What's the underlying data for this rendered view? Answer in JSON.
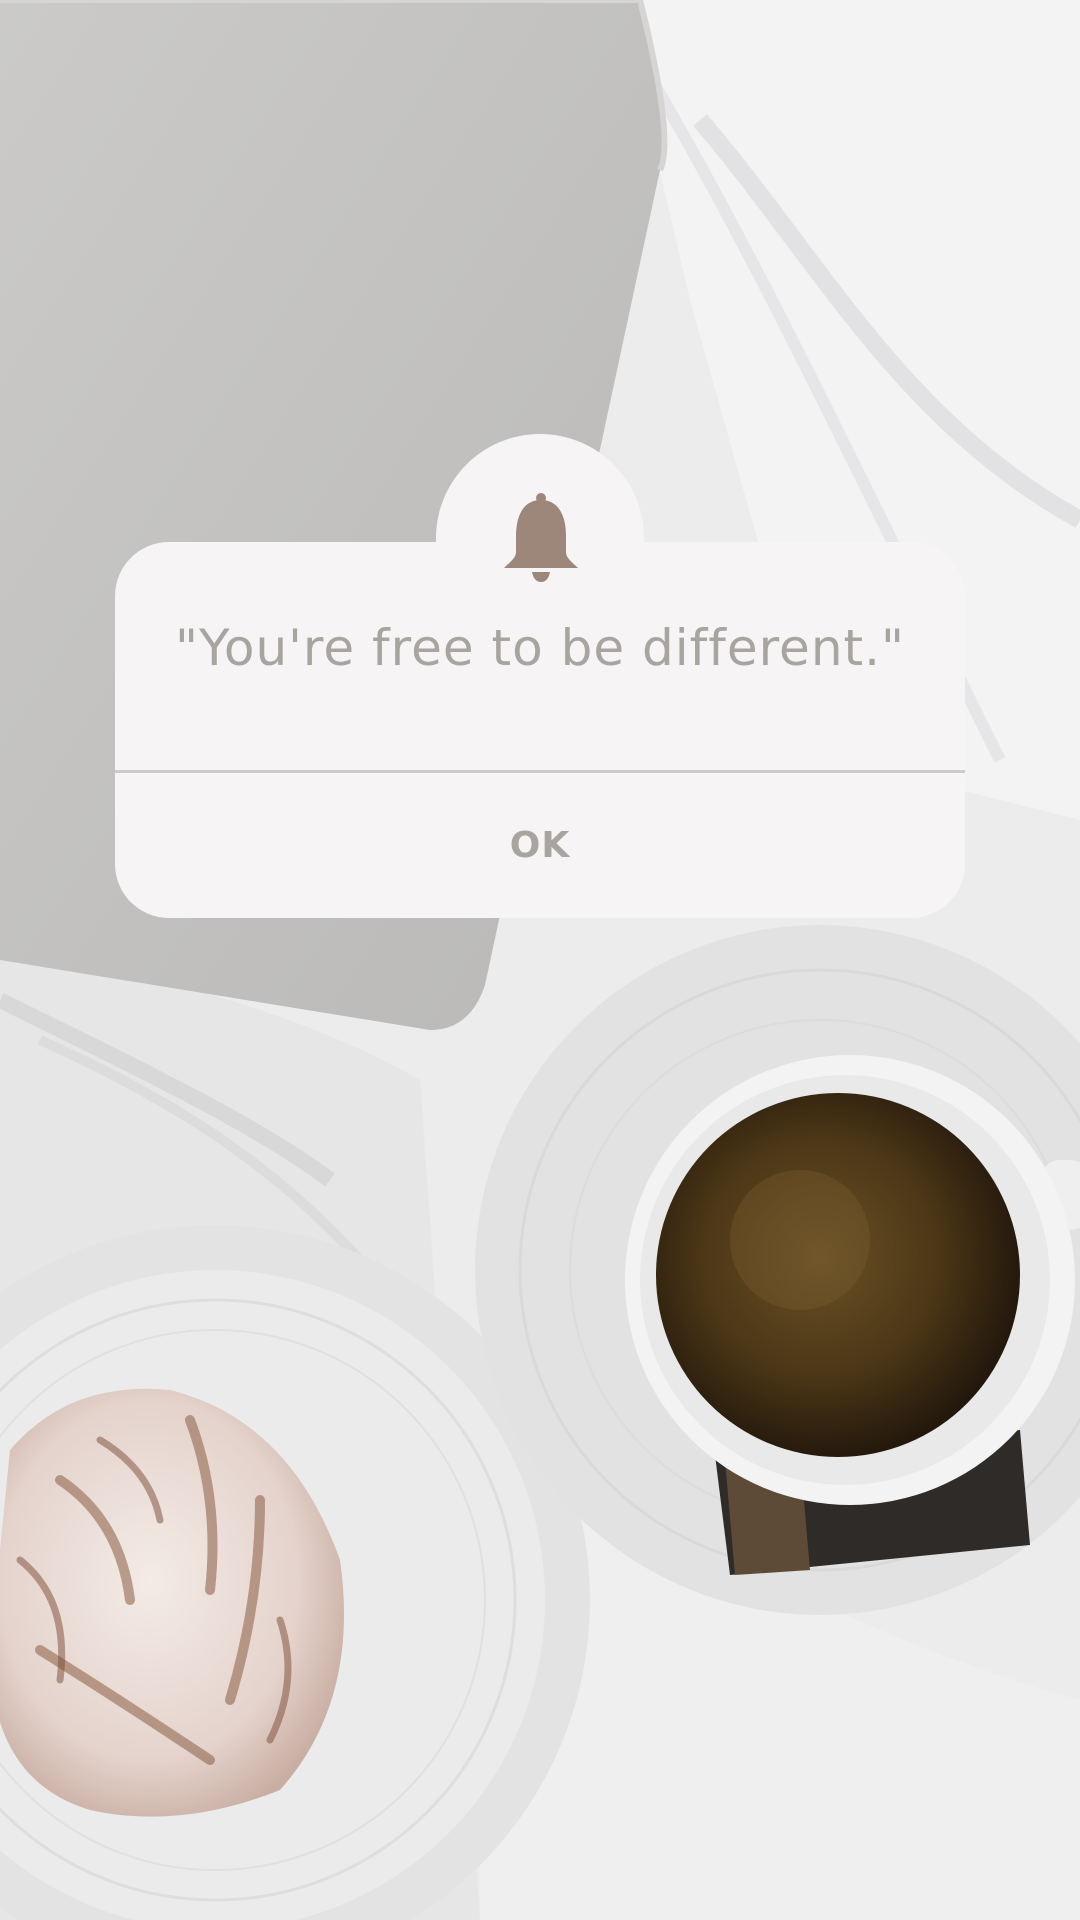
{
  "dialog": {
    "icon": "bell-icon",
    "message": "\"You're free to be different.\"",
    "ok_label": "OK"
  },
  "colors": {
    "card": "#f6f4f4",
    "text": "#a8a4a0",
    "bell": "#9d877a",
    "divider": "#cdcbc9"
  }
}
